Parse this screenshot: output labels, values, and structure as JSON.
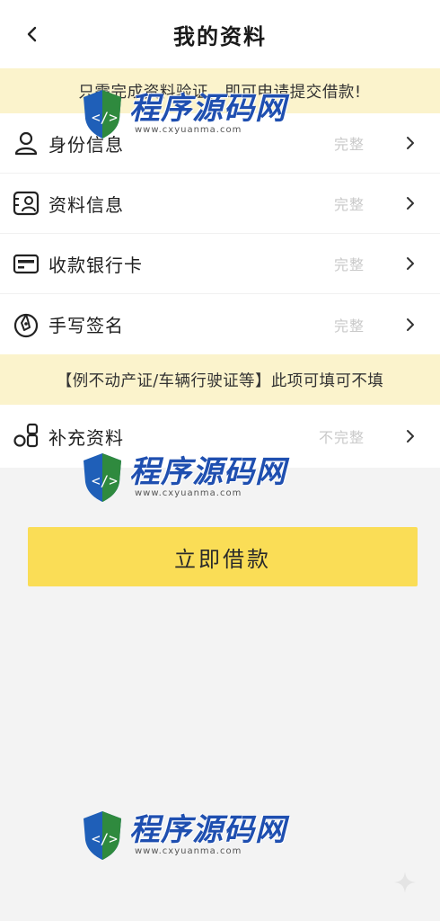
{
  "header": {
    "title": "我的资料"
  },
  "notice_top": "只需完成资料验证，即可申请提交借款!",
  "items": [
    {
      "label": "身份信息",
      "status": "完整",
      "icon": "person-icon"
    },
    {
      "label": "资料信息",
      "status": "完整",
      "icon": "profile-card-icon"
    },
    {
      "label": "收款银行卡",
      "status": "完整",
      "icon": "bank-card-icon"
    },
    {
      "label": "手写签名",
      "status": "完整",
      "icon": "signature-icon"
    }
  ],
  "notice_optional": "【例不动产证/车辆行驶证等】此项可填可不填",
  "extra_item": {
    "label": "补充资料",
    "status": "不完整",
    "icon": "shapes-icon"
  },
  "submit_label": "立即借款",
  "watermark": {
    "title": "程序源码网",
    "url": "www.cxyuanma.com"
  },
  "colors": {
    "accent": "#fadd56",
    "notice_bg": "#fbf3cc",
    "status_text": "#c9c9c9"
  }
}
